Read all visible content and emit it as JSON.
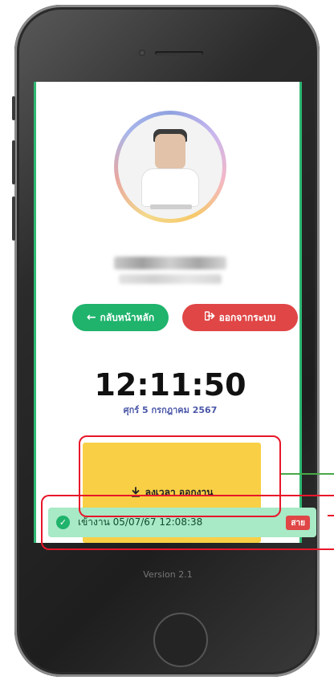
{
  "nav": {
    "home_label": "กลับหน้าหลัก",
    "logout_label": "ออกจากระบบ"
  },
  "clock": {
    "time": "12:11:50",
    "date": "ศุกร์ 5 กรกฎาคม 2567"
  },
  "checkout": {
    "label": "ลงเวลา ออกงาน"
  },
  "checkin_status": {
    "text": "เข้างาน 05/07/67 12:08:38",
    "badge": "สาย"
  },
  "version": "Version 2.1",
  "icons": {
    "home": "arrow-left-icon",
    "logout": "sign-out-icon",
    "checkout": "download-icon",
    "status": "check-circle-icon"
  },
  "colors": {
    "primary_green": "#1fb36c",
    "danger_red": "#e04646",
    "warning_yellow": "#f9cf45",
    "success_light": "#a8e9c6",
    "date_blue": "#4b57a8"
  }
}
